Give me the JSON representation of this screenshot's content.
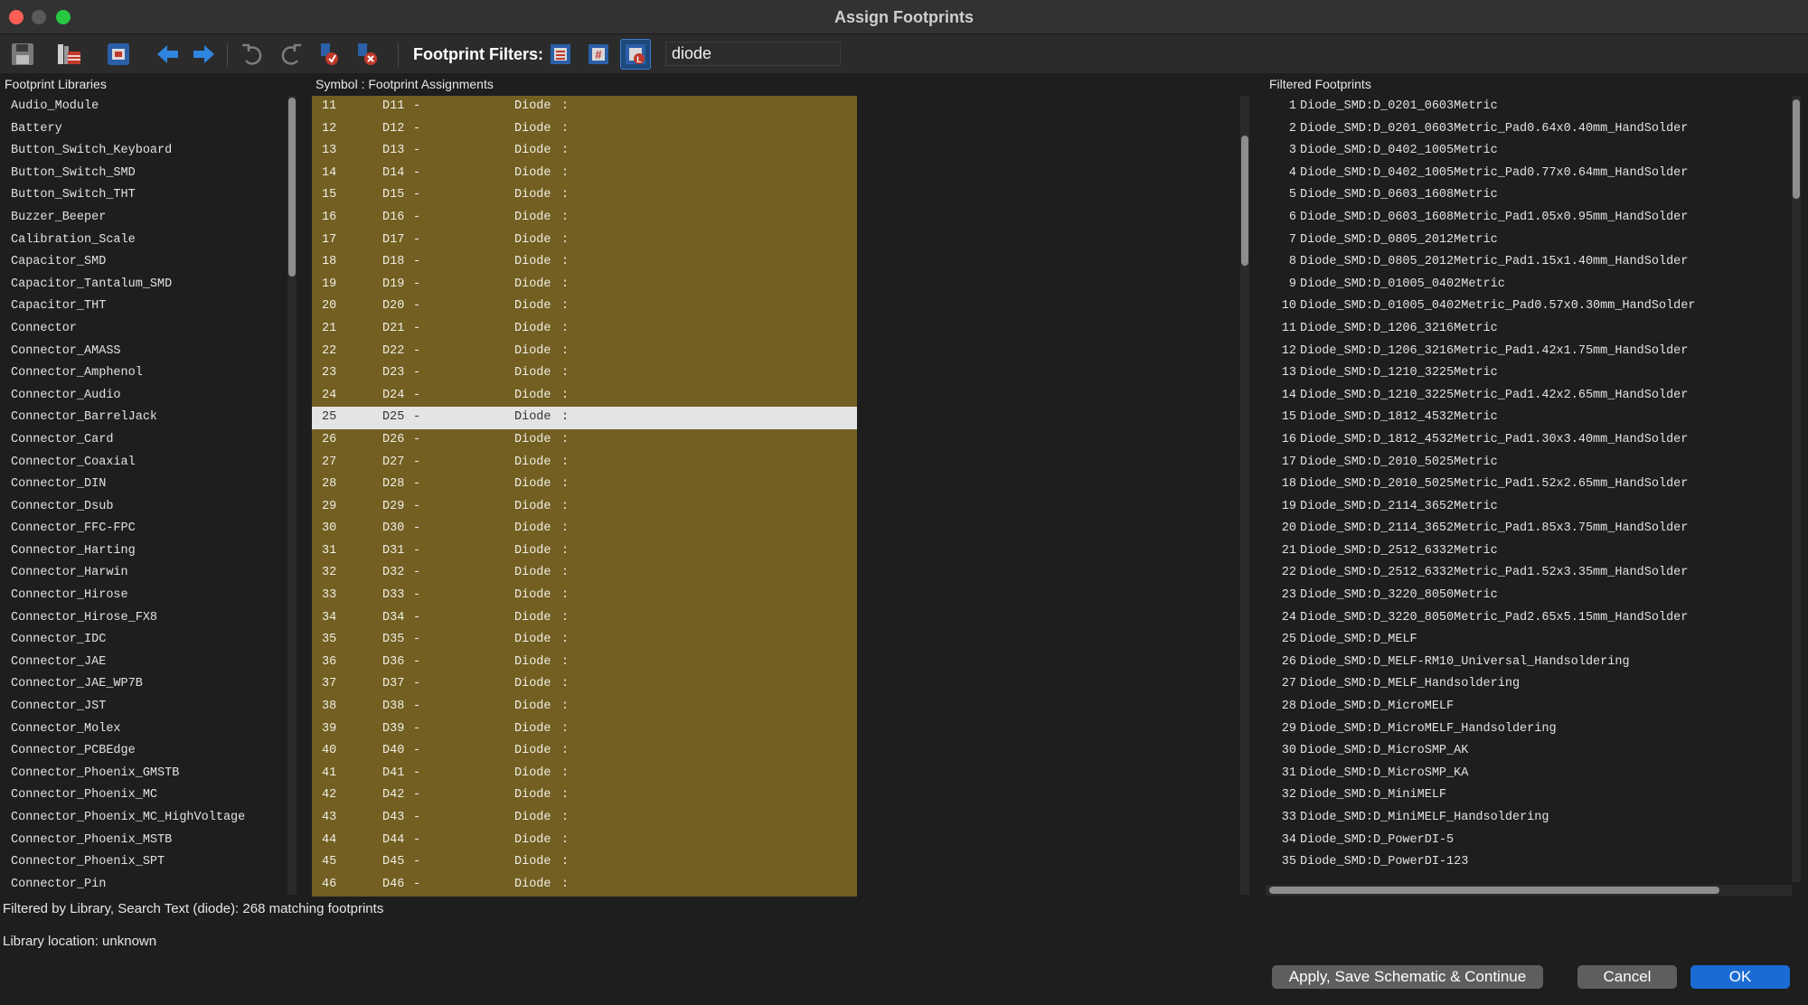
{
  "window": {
    "title": "Assign Footprints"
  },
  "toolbar": {
    "filters_label": "Footprint Filters:",
    "search_value": "diode"
  },
  "panels": {
    "libraries_title": "Footprint Libraries",
    "assignments_title": "Symbol : Footprint Assignments",
    "filtered_title": "Filtered Footprints"
  },
  "libraries": [
    "Audio_Module",
    "Battery",
    "Button_Switch_Keyboard",
    "Button_Switch_SMD",
    "Button_Switch_THT",
    "Buzzer_Beeper",
    "Calibration_Scale",
    "Capacitor_SMD",
    "Capacitor_Tantalum_SMD",
    "Capacitor_THT",
    "Connector",
    "Connector_AMASS",
    "Connector_Amphenol",
    "Connector_Audio",
    "Connector_BarrelJack",
    "Connector_Card",
    "Connector_Coaxial",
    "Connector_DIN",
    "Connector_Dsub",
    "Connector_FFC-FPC",
    "Connector_Harting",
    "Connector_Harwin",
    "Connector_Hirose",
    "Connector_Hirose_FX8",
    "Connector_IDC",
    "Connector_JAE",
    "Connector_JAE_WP7B",
    "Connector_JST",
    "Connector_Molex",
    "Connector_PCBEdge",
    "Connector_Phoenix_GMSTB",
    "Connector_Phoenix_MC",
    "Connector_Phoenix_MC_HighVoltage",
    "Connector_Phoenix_MSTB",
    "Connector_Phoenix_SPT",
    "Connector_Pin"
  ],
  "assignments": [
    {
      "num": "11",
      "ref": "D11",
      "dash": "-",
      "value": "Diode",
      "colon": ":"
    },
    {
      "num": "12",
      "ref": "D12",
      "dash": "-",
      "value": "Diode",
      "colon": ":"
    },
    {
      "num": "13",
      "ref": "D13",
      "dash": "-",
      "value": "Diode",
      "colon": ":"
    },
    {
      "num": "14",
      "ref": "D14",
      "dash": "-",
      "value": "Diode",
      "colon": ":"
    },
    {
      "num": "15",
      "ref": "D15",
      "dash": "-",
      "value": "Diode",
      "colon": ":"
    },
    {
      "num": "16",
      "ref": "D16",
      "dash": "-",
      "value": "Diode",
      "colon": ":"
    },
    {
      "num": "17",
      "ref": "D17",
      "dash": "-",
      "value": "Diode",
      "colon": ":"
    },
    {
      "num": "18",
      "ref": "D18",
      "dash": "-",
      "value": "Diode",
      "colon": ":"
    },
    {
      "num": "19",
      "ref": "D19",
      "dash": "-",
      "value": "Diode",
      "colon": ":"
    },
    {
      "num": "20",
      "ref": "D20",
      "dash": "-",
      "value": "Diode",
      "colon": ":"
    },
    {
      "num": "21",
      "ref": "D21",
      "dash": "-",
      "value": "Diode",
      "colon": ":"
    },
    {
      "num": "22",
      "ref": "D22",
      "dash": "-",
      "value": "Diode",
      "colon": ":"
    },
    {
      "num": "23",
      "ref": "D23",
      "dash": "-",
      "value": "Diode",
      "colon": ":"
    },
    {
      "num": "24",
      "ref": "D24",
      "dash": "-",
      "value": "Diode",
      "colon": ":"
    },
    {
      "num": "25",
      "ref": "D25",
      "dash": "-",
      "value": "Diode",
      "colon": ":",
      "selected": true
    },
    {
      "num": "26",
      "ref": "D26",
      "dash": "-",
      "value": "Diode",
      "colon": ":"
    },
    {
      "num": "27",
      "ref": "D27",
      "dash": "-",
      "value": "Diode",
      "colon": ":"
    },
    {
      "num": "28",
      "ref": "D28",
      "dash": "-",
      "value": "Diode",
      "colon": ":"
    },
    {
      "num": "29",
      "ref": "D29",
      "dash": "-",
      "value": "Diode",
      "colon": ":"
    },
    {
      "num": "30",
      "ref": "D30",
      "dash": "-",
      "value": "Diode",
      "colon": ":"
    },
    {
      "num": "31",
      "ref": "D31",
      "dash": "-",
      "value": "Diode",
      "colon": ":"
    },
    {
      "num": "32",
      "ref": "D32",
      "dash": "-",
      "value": "Diode",
      "colon": ":"
    },
    {
      "num": "33",
      "ref": "D33",
      "dash": "-",
      "value": "Diode",
      "colon": ":"
    },
    {
      "num": "34",
      "ref": "D34",
      "dash": "-",
      "value": "Diode",
      "colon": ":"
    },
    {
      "num": "35",
      "ref": "D35",
      "dash": "-",
      "value": "Diode",
      "colon": ":"
    },
    {
      "num": "36",
      "ref": "D36",
      "dash": "-",
      "value": "Diode",
      "colon": ":"
    },
    {
      "num": "37",
      "ref": "D37",
      "dash": "-",
      "value": "Diode",
      "colon": ":"
    },
    {
      "num": "38",
      "ref": "D38",
      "dash": "-",
      "value": "Diode",
      "colon": ":"
    },
    {
      "num": "39",
      "ref": "D39",
      "dash": "-",
      "value": "Diode",
      "colon": ":"
    },
    {
      "num": "40",
      "ref": "D40",
      "dash": "-",
      "value": "Diode",
      "colon": ":"
    },
    {
      "num": "41",
      "ref": "D41",
      "dash": "-",
      "value": "Diode",
      "colon": ":"
    },
    {
      "num": "42",
      "ref": "D42",
      "dash": "-",
      "value": "Diode",
      "colon": ":"
    },
    {
      "num": "43",
      "ref": "D43",
      "dash": "-",
      "value": "Diode",
      "colon": ":"
    },
    {
      "num": "44",
      "ref": "D44",
      "dash": "-",
      "value": "Diode",
      "colon": ":"
    },
    {
      "num": "45",
      "ref": "D45",
      "dash": "-",
      "value": "Diode",
      "colon": ":"
    },
    {
      "num": "46",
      "ref": "D46",
      "dash": "-",
      "value": "Diode",
      "colon": ":"
    }
  ],
  "footprints": [
    {
      "num": "1",
      "name": "Diode_SMD:D_0201_0603Metric"
    },
    {
      "num": "2",
      "name": "Diode_SMD:D_0201_0603Metric_Pad0.64x0.40mm_HandSolder"
    },
    {
      "num": "3",
      "name": "Diode_SMD:D_0402_1005Metric"
    },
    {
      "num": "4",
      "name": "Diode_SMD:D_0402_1005Metric_Pad0.77x0.64mm_HandSolder"
    },
    {
      "num": "5",
      "name": "Diode_SMD:D_0603_1608Metric"
    },
    {
      "num": "6",
      "name": "Diode_SMD:D_0603_1608Metric_Pad1.05x0.95mm_HandSolder"
    },
    {
      "num": "7",
      "name": "Diode_SMD:D_0805_2012Metric"
    },
    {
      "num": "8",
      "name": "Diode_SMD:D_0805_2012Metric_Pad1.15x1.40mm_HandSolder"
    },
    {
      "num": "9",
      "name": "Diode_SMD:D_01005_0402Metric"
    },
    {
      "num": "10",
      "name": "Diode_SMD:D_01005_0402Metric_Pad0.57x0.30mm_HandSolder"
    },
    {
      "num": "11",
      "name": "Diode_SMD:D_1206_3216Metric"
    },
    {
      "num": "12",
      "name": "Diode_SMD:D_1206_3216Metric_Pad1.42x1.75mm_HandSolder"
    },
    {
      "num": "13",
      "name": "Diode_SMD:D_1210_3225Metric"
    },
    {
      "num": "14",
      "name": "Diode_SMD:D_1210_3225Metric_Pad1.42x2.65mm_HandSolder"
    },
    {
      "num": "15",
      "name": "Diode_SMD:D_1812_4532Metric"
    },
    {
      "num": "16",
      "name": "Diode_SMD:D_1812_4532Metric_Pad1.30x3.40mm_HandSolder"
    },
    {
      "num": "17",
      "name": "Diode_SMD:D_2010_5025Metric"
    },
    {
      "num": "18",
      "name": "Diode_SMD:D_2010_5025Metric_Pad1.52x2.65mm_HandSolder"
    },
    {
      "num": "19",
      "name": "Diode_SMD:D_2114_3652Metric"
    },
    {
      "num": "20",
      "name": "Diode_SMD:D_2114_3652Metric_Pad1.85x3.75mm_HandSolder"
    },
    {
      "num": "21",
      "name": "Diode_SMD:D_2512_6332Metric"
    },
    {
      "num": "22",
      "name": "Diode_SMD:D_2512_6332Metric_Pad1.52x3.35mm_HandSolder"
    },
    {
      "num": "23",
      "name": "Diode_SMD:D_3220_8050Metric"
    },
    {
      "num": "24",
      "name": "Diode_SMD:D_3220_8050Metric_Pad2.65x5.15mm_HandSolder"
    },
    {
      "num": "25",
      "name": "Diode_SMD:D_MELF"
    },
    {
      "num": "26",
      "name": "Diode_SMD:D_MELF-RM10_Universal_Handsoldering"
    },
    {
      "num": "27",
      "name": "Diode_SMD:D_MELF_Handsoldering"
    },
    {
      "num": "28",
      "name": "Diode_SMD:D_MicroMELF"
    },
    {
      "num": "29",
      "name": "Diode_SMD:D_MicroMELF_Handsoldering"
    },
    {
      "num": "30",
      "name": "Diode_SMD:D_MicroSMP_AK"
    },
    {
      "num": "31",
      "name": "Diode_SMD:D_MicroSMP_KA"
    },
    {
      "num": "32",
      "name": "Diode_SMD:D_MiniMELF"
    },
    {
      "num": "33",
      "name": "Diode_SMD:D_MiniMELF_Handsoldering"
    },
    {
      "num": "34",
      "name": "Diode_SMD:D_PowerDI-5"
    },
    {
      "num": "35",
      "name": "Diode_SMD:D_PowerDI-123"
    }
  ],
  "status": {
    "filter_text": "Filtered by Library, Search Text (diode): 268 matching footprints",
    "library_location": "Library location: unknown"
  },
  "buttons": {
    "apply": "Apply, Save Schematic & Continue",
    "cancel": "Cancel",
    "ok": "OK"
  },
  "colors": {
    "assign_bg": "#725f21",
    "selection": "#e4e4e4",
    "ok_button": "#1a6cd4"
  },
  "icons": {
    "save": "save-icon",
    "library_table": "library-table-icon",
    "footprint_viewer": "footprint-viewer-icon",
    "prev": "arrow-left-icon",
    "next": "arrow-right-icon",
    "undo": "undo-icon",
    "redo": "redo-icon",
    "auto_assign": "auto-assign-icon",
    "delete_all": "delete-all-icon",
    "filter_keywords": "filter-keywords-icon",
    "filter_pins": "filter-pin-count-icon",
    "filter_library": "filter-library-icon"
  }
}
